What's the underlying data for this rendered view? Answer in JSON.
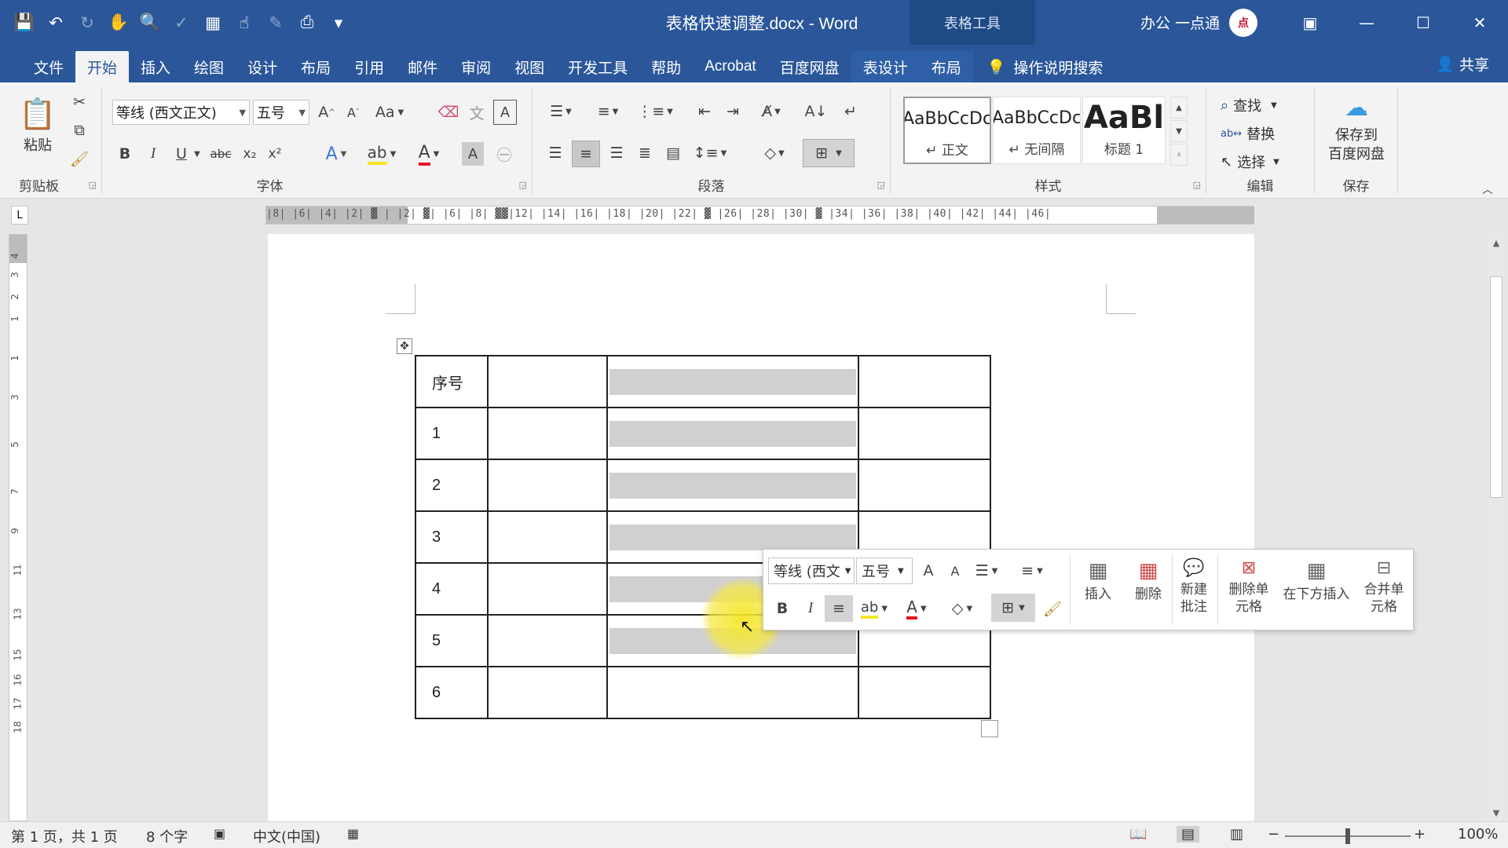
{
  "title_bar": {
    "doc_title": "表格快速调整.docx - Word",
    "context_title": "表格工具",
    "user_name": "办公 一点通",
    "avatar_text": "点",
    "qat_icons": [
      "save-icon",
      "undo-icon",
      "redo-icon",
      "touch-mode-icon",
      "print-preview-icon",
      "spelling-icon",
      "track-icon",
      "touch-icon",
      "draw-icon",
      "preview-icon",
      "customize-icon"
    ]
  },
  "tabs": [
    "文件",
    "开始",
    "插入",
    "绘图",
    "设计",
    "布局",
    "引用",
    "邮件",
    "审阅",
    "视图",
    "开发工具",
    "帮助",
    "Acrobat",
    "百度网盘"
  ],
  "context_tabs": [
    "表设计",
    "布局"
  ],
  "active_tab": "开始",
  "tell_me": "操作说明搜索",
  "share": "共享",
  "ribbon": {
    "clipboard": {
      "label": "剪贴板",
      "paste": "粘贴"
    },
    "font": {
      "label": "字体",
      "font_name": "等线 (西文正文)",
      "font_size": "五号",
      "case_btn": "Aa",
      "bold": "B",
      "italic": "I",
      "underline": "U",
      "strike": "abc",
      "sub": "x₂",
      "sup": "x²"
    },
    "paragraph": {
      "label": "段落"
    },
    "styles": {
      "label": "样式",
      "items": [
        {
          "preview": "AaBbCcDc",
          "name": "↵ 正文"
        },
        {
          "preview": "AaBbCcDc",
          "name": "↵ 无间隔"
        },
        {
          "preview": "AaBl",
          "name": "标题 1"
        }
      ]
    },
    "editing": {
      "label": "编辑",
      "find": "查找",
      "replace": "替换",
      "select": "选择"
    },
    "save": {
      "label": "保存",
      "baidu": "保存到\n百度网盘",
      "baidu_line1": "保存到",
      "baidu_line2": "百度网盘"
    }
  },
  "ruler": {
    "h_ticks": "|8|  |6|  |4|  |2|  ▓  |  |2|  ▓|  |6|  |8|  ▓▓|12|  |14|  |16|  |18|  |20|  |22|  ▓  |26|  |28|  |30|  ▓  |34|  |36|  |38|  |40|  |42|  |44|  |46|",
    "v_ticks": [
      "4",
      "3",
      "2",
      "1",
      "1",
      "3",
      "5",
      "7",
      "9",
      "11",
      "13",
      "15",
      "16",
      "17",
      "18"
    ]
  },
  "table": {
    "rows": [
      [
        "序号",
        "",
        "",
        ""
      ],
      [
        "1",
        "",
        "",
        ""
      ],
      [
        "2",
        "",
        "",
        ""
      ],
      [
        "3",
        "",
        "",
        ""
      ],
      [
        "4",
        "",
        "",
        ""
      ],
      [
        "5",
        "",
        "",
        ""
      ],
      [
        "6",
        "",
        "",
        ""
      ]
    ],
    "shaded_rows": [
      0,
      1,
      2,
      3,
      4,
      5
    ]
  },
  "mini_toolbar": {
    "font_name": "等线 (西文",
    "font_size": "五号",
    "bold": "B",
    "italic": "I",
    "insert": "插入",
    "delete": "删除",
    "new_comment_l1": "新建",
    "new_comment_l2": "批注",
    "delete_cell_l1": "删除单",
    "delete_cell_l2": "元格",
    "insert_below": "在下方插入",
    "merge_l1": "合并单",
    "merge_l2": "元格"
  },
  "status": {
    "page": "第 1 页，共 1 页",
    "words": "8 个字",
    "language": "中文(中国)",
    "zoom": "100%",
    "zoom_level": 0.5
  },
  "colors": {
    "accent": "#2b579a",
    "highlight": "#f5e628",
    "font_color": "#e81123"
  }
}
